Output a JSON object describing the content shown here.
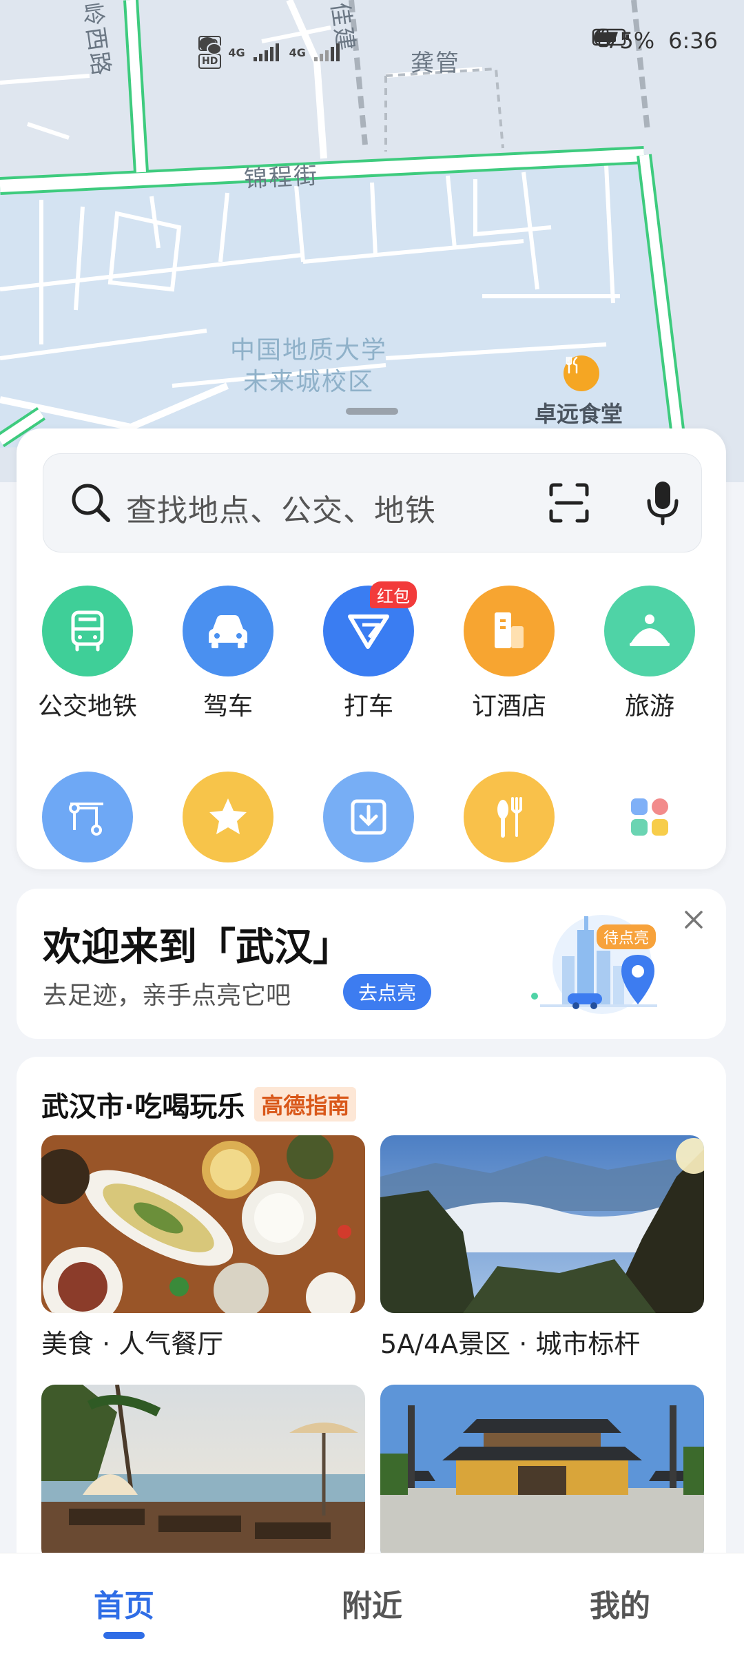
{
  "status_bar": {
    "hd1": "HD",
    "hd2": "HD",
    "net1": "4G",
    "net2": "4G",
    "battery": "75%",
    "time": "6:36"
  },
  "map": {
    "road_labels": [
      "岭西路",
      "佳建",
      "龚管",
      "锦程街"
    ],
    "campus_line1": "中国地质大学",
    "campus_line2": "未来城校区",
    "poi_label": "卓远食堂"
  },
  "search": {
    "placeholder": "查找地点、公交、地铁"
  },
  "quick_actions": [
    {
      "label": "公交地铁",
      "icon": "bus-icon",
      "color": "#3fcf98"
    },
    {
      "label": "驾车",
      "icon": "car-icon",
      "color": "#4a90f0"
    },
    {
      "label": "打车",
      "icon": "taxi-icon",
      "color": "#3a7df2",
      "badge": "红包"
    },
    {
      "label": "订酒店",
      "icon": "hotel-icon",
      "color": "#f7a531"
    },
    {
      "label": "旅游",
      "icon": "travel-icon",
      "color": "#4fd3a6"
    }
  ],
  "secondary_actions": [
    {
      "icon": "route-icon",
      "color": "#6ea8f5"
    },
    {
      "icon": "star-icon",
      "color": "#f7c44a"
    },
    {
      "icon": "download-icon",
      "color": "#77aef5"
    },
    {
      "icon": "food-icon",
      "color": "#f9c14a"
    },
    {
      "icon": "more-apps-icon",
      "color": "#ffffff"
    }
  ],
  "welcome": {
    "title": "欢迎来到「武汉」",
    "subtitle": "去足迹，亲手点亮它吧",
    "button": "去点亮",
    "pending_tag": "待点亮"
  },
  "guide": {
    "title": "武汉市·吃喝玩乐",
    "tag": "高德指南",
    "tiles": [
      {
        "caption": "美食 · 人气餐厅"
      },
      {
        "caption": "5A/4A景区 · 城市标杆"
      },
      {
        "caption": ""
      },
      {
        "caption": ""
      }
    ]
  },
  "tabs": [
    "首页",
    "附近",
    "我的"
  ],
  "colors": {
    "accent": "#2f6de6",
    "road_green": "#3ecb7e"
  }
}
